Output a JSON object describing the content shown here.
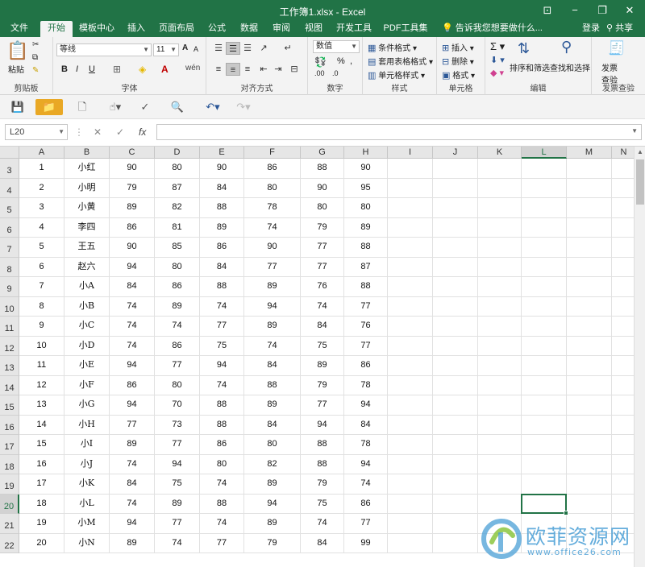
{
  "window": {
    "title": "工作簿1.xlsx - Excel",
    "btn_ribbon_opts": "⊡",
    "btn_minimize": "−",
    "btn_restore": "❐",
    "btn_close": "✕"
  },
  "tabs": [
    "文件",
    "开始",
    "模板中心",
    "插入",
    "页面布局",
    "公式",
    "数据",
    "审阅",
    "视图",
    "开发工具",
    "PDF工具集"
  ],
  "tell_me": "告诉我您想要做什么...",
  "account": {
    "login": "登录",
    "share": "共享"
  },
  "ribbon": {
    "clipboard": {
      "label": "剪贴板",
      "paste": "粘贴"
    },
    "font": {
      "label": "字体",
      "family": "等线",
      "size": "11",
      "bold": "B",
      "italic": "I",
      "underline": "U",
      "grow": "A",
      "shrink": "A"
    },
    "alignment": {
      "label": "对齐方式"
    },
    "number": {
      "label": "数字",
      "format": "数值"
    },
    "styles": {
      "label": "样式",
      "cond": "条件格式",
      "table": "套用表格格式",
      "cell": "单元格样式"
    },
    "cells": {
      "label": "单元格",
      "insert": "插入",
      "delete": "删除",
      "format": "格式"
    },
    "editing": {
      "label": "编辑",
      "sort": "排序和筛选",
      "find": "查找和选择"
    },
    "invoice": {
      "label": "发票查验",
      "btn_line1": "发票",
      "btn_line2": "查验"
    }
  },
  "formula": {
    "name_box": "L20",
    "fx": "fx",
    "cancel": "✕",
    "enter": "✓"
  },
  "grid": {
    "columns": [
      "A",
      "B",
      "C",
      "D",
      "E",
      "F",
      "G",
      "H",
      "I",
      "J",
      "K",
      "L",
      "M",
      "N"
    ],
    "active_column": "L",
    "active_row": "20",
    "rows": [
      {
        "r": "3",
        "cells": [
          "1",
          "小红",
          "90",
          "80",
          "90",
          "86",
          "88",
          "90"
        ]
      },
      {
        "r": "4",
        "cells": [
          "2",
          "小明",
          "79",
          "87",
          "84",
          "80",
          "90",
          "95"
        ]
      },
      {
        "r": "5",
        "cells": [
          "3",
          "小黄",
          "89",
          "82",
          "88",
          "78",
          "80",
          "80"
        ]
      },
      {
        "r": "6",
        "cells": [
          "4",
          "李四",
          "86",
          "81",
          "89",
          "74",
          "79",
          "89"
        ]
      },
      {
        "r": "7",
        "cells": [
          "5",
          "王五",
          "90",
          "85",
          "86",
          "90",
          "77",
          "88"
        ]
      },
      {
        "r": "8",
        "cells": [
          "6",
          "赵六",
          "94",
          "80",
          "84",
          "77",
          "77",
          "87"
        ]
      },
      {
        "r": "9",
        "cells": [
          "7",
          "小A",
          "84",
          "86",
          "88",
          "89",
          "76",
          "88"
        ]
      },
      {
        "r": "10",
        "cells": [
          "8",
          "小B",
          "74",
          "89",
          "74",
          "94",
          "74",
          "77"
        ]
      },
      {
        "r": "11",
        "cells": [
          "9",
          "小C",
          "74",
          "74",
          "77",
          "89",
          "84",
          "76"
        ]
      },
      {
        "r": "12",
        "cells": [
          "10",
          "小D",
          "74",
          "86",
          "75",
          "74",
          "75",
          "77"
        ]
      },
      {
        "r": "13",
        "cells": [
          "11",
          "小E",
          "94",
          "77",
          "94",
          "84",
          "89",
          "86"
        ]
      },
      {
        "r": "14",
        "cells": [
          "12",
          "小F",
          "86",
          "80",
          "74",
          "88",
          "79",
          "78"
        ]
      },
      {
        "r": "15",
        "cells": [
          "13",
          "小G",
          "94",
          "70",
          "88",
          "89",
          "77",
          "94"
        ]
      },
      {
        "r": "16",
        "cells": [
          "14",
          "小H",
          "77",
          "73",
          "88",
          "84",
          "94",
          "84"
        ]
      },
      {
        "r": "17",
        "cells": [
          "15",
          "小I",
          "89",
          "77",
          "86",
          "80",
          "88",
          "78"
        ]
      },
      {
        "r": "18",
        "cells": [
          "16",
          "小J",
          "74",
          "94",
          "80",
          "82",
          "88",
          "94"
        ]
      },
      {
        "r": "19",
        "cells": [
          "17",
          "小K",
          "84",
          "75",
          "74",
          "89",
          "79",
          "74"
        ]
      },
      {
        "r": "20",
        "cells": [
          "18",
          "小L",
          "74",
          "89",
          "88",
          "94",
          "75",
          "86"
        ]
      },
      {
        "r": "21",
        "cells": [
          "19",
          "小M",
          "94",
          "77",
          "74",
          "89",
          "74",
          "77"
        ]
      },
      {
        "r": "22",
        "cells": [
          "20",
          "小N",
          "89",
          "74",
          "77",
          "79",
          "84",
          "99"
        ]
      }
    ]
  },
  "watermark": {
    "text": "欧菲资源网",
    "url": "www.office26.com"
  },
  "colors": {
    "accent": "#217346",
    "watermark": "#4a9fd6"
  }
}
